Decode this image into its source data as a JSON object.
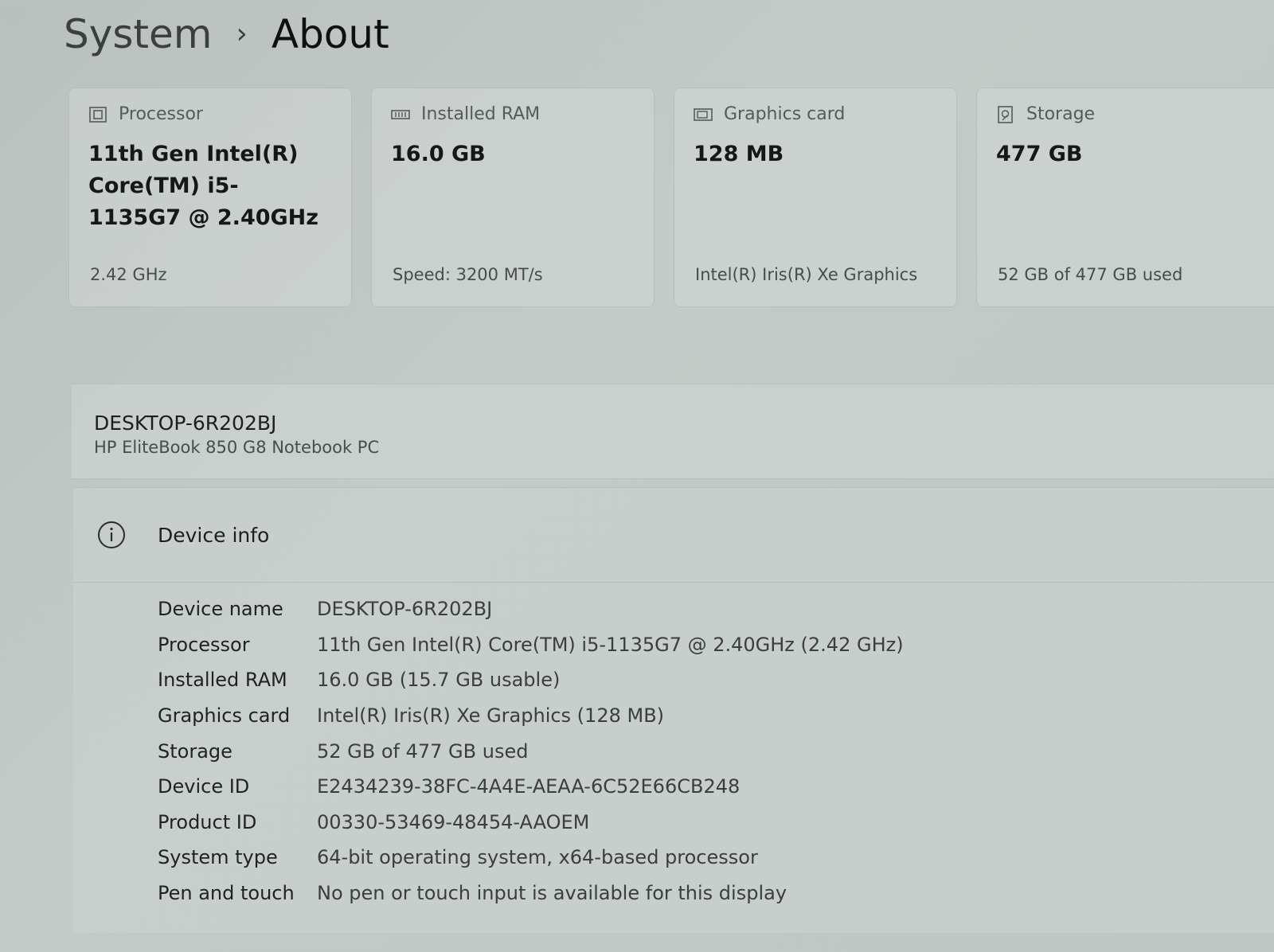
{
  "breadcrumb": {
    "parent": "System",
    "separator": "›",
    "current": "About"
  },
  "cards": [
    {
      "label": "Processor",
      "icon": "processor-icon",
      "value": "11th Gen Intel(R) Core(TM) i5-1135G7 @ 2.40GHz",
      "sub": "2.42 GHz"
    },
    {
      "label": "Installed RAM",
      "icon": "ram-icon",
      "value": "16.0 GB",
      "sub": "Speed: 3200 MT/s"
    },
    {
      "label": "Graphics card",
      "icon": "graphics-card-icon",
      "value": "128 MB",
      "sub": "Intel(R) Iris(R) Xe Graphics"
    },
    {
      "label": "Storage",
      "icon": "storage-icon",
      "value": "477 GB",
      "sub": "52 GB of 477 GB used"
    }
  ],
  "device": {
    "name": "DESKTOP-6R202BJ",
    "model": "HP EliteBook 850 G8 Notebook PC"
  },
  "device_info": {
    "title": "Device info",
    "icon": "info-icon",
    "rows": [
      {
        "label": "Device name",
        "value": "DESKTOP-6R202BJ"
      },
      {
        "label": "Processor",
        "value": "11th Gen Intel(R) Core(TM) i5-1135G7 @ 2.40GHz (2.42 GHz)"
      },
      {
        "label": "Installed RAM",
        "value": "16.0 GB (15.7 GB usable)"
      },
      {
        "label": "Graphics card",
        "value": "Intel(R) Iris(R) Xe Graphics (128 MB)"
      },
      {
        "label": "Storage",
        "value": "52 GB of 477 GB used"
      },
      {
        "label": "Device ID",
        "value": "E2434239-38FC-4A4E-AEAA-6C52E66CB248"
      },
      {
        "label": "Product ID",
        "value": "00330-53469-48454-AAOEM"
      },
      {
        "label": "System type",
        "value": "64-bit operating system, x64-based processor"
      },
      {
        "label": "Pen and touch",
        "value": "No pen or touch input is available for this display"
      }
    ]
  }
}
